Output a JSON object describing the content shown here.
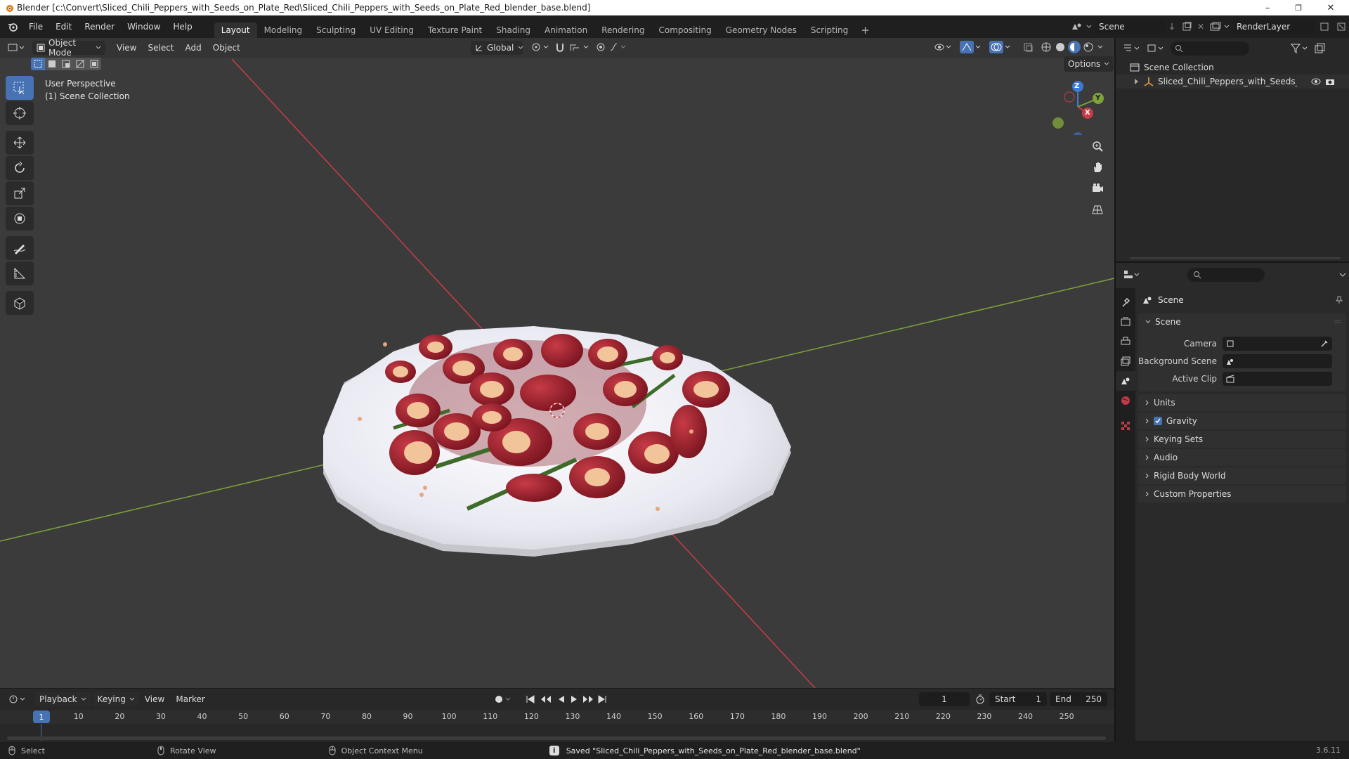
{
  "window": {
    "title": "Blender [c:\\Convert\\Sliced_Chili_Peppers_with_Seeds_on_Plate_Red\\Sliced_Chili_Peppers_with_Seeds_on_Plate_Red_blender_base.blend]",
    "minimize": "–",
    "maximize": "❐",
    "close": "✕"
  },
  "menu": [
    "File",
    "Edit",
    "Render",
    "Window",
    "Help"
  ],
  "workspaces": [
    "Layout",
    "Modeling",
    "Sculpting",
    "UV Editing",
    "Texture Paint",
    "Shading",
    "Animation",
    "Rendering",
    "Compositing",
    "Geometry Nodes",
    "Scripting"
  ],
  "workspace_add": "+",
  "scene_selector": {
    "value": "Scene"
  },
  "renderlayer_selector": {
    "value": "RenderLayer"
  },
  "viewport": {
    "mode": "Object Mode",
    "menus": [
      "View",
      "Select",
      "Add",
      "Object"
    ],
    "transform_orientation": "Global",
    "options_label": "Options",
    "overlay_line1": "User Perspective",
    "overlay_line2": "(1) Scene Collection",
    "gizmo": {
      "z": "Z",
      "y": "Y",
      "x": "X"
    }
  },
  "outliner": {
    "root": "Scene Collection",
    "item": "Sliced_Chili_Peppers_with_Seeds_on_Pla"
  },
  "properties": {
    "header_title": "Scene",
    "panel_title": "Scene",
    "fields": [
      {
        "label": "Camera"
      },
      {
        "label": "Background Scene"
      },
      {
        "label": "Active Clip"
      }
    ],
    "sections": [
      "Units",
      "Gravity",
      "Keying Sets",
      "Audio",
      "Rigid Body World",
      "Custom Properties"
    ]
  },
  "timeline": {
    "menus": [
      "Playback",
      "Keying",
      "View",
      "Marker"
    ],
    "current_frame": "1",
    "start_label": "Start",
    "start_value": "1",
    "end_label": "End",
    "end_value": "250",
    "ruler_current": "1",
    "ticks": [
      "10",
      "20",
      "30",
      "40",
      "50",
      "60",
      "70",
      "80",
      "90",
      "100",
      "110",
      "120",
      "130",
      "140",
      "150",
      "160",
      "170",
      "180",
      "190",
      "200",
      "210",
      "220",
      "230",
      "240",
      "250"
    ]
  },
  "statusbar": {
    "select": "Select",
    "rotate": "Rotate View",
    "context": "Object Context Menu",
    "message": "Saved \"Sliced_Chili_Peppers_with_Seeds_on_Plate_Red_blender_base.blend\"",
    "version": "3.6.11"
  },
  "colors": {
    "accent": "#4772b3",
    "x_axis": "#c83c46",
    "y_axis": "#7ea33a",
    "z_axis": "#3b7bd6"
  }
}
